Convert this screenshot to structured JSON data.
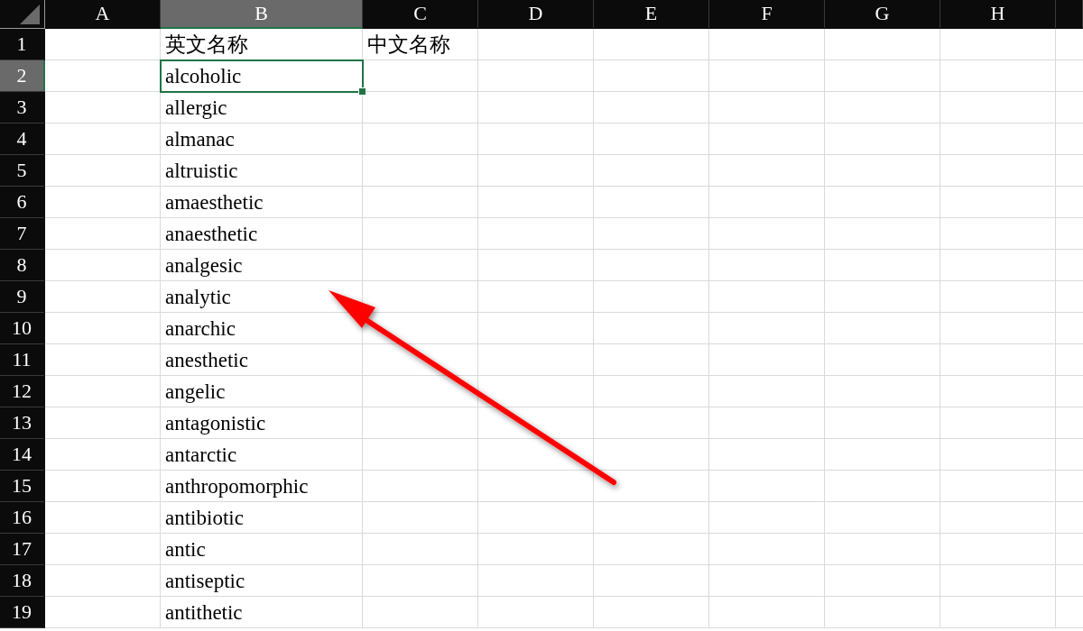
{
  "columns": [
    {
      "label": "A",
      "selected": false
    },
    {
      "label": "B",
      "selected": true
    },
    {
      "label": "C",
      "selected": false
    },
    {
      "label": "D",
      "selected": false
    },
    {
      "label": "E",
      "selected": false
    },
    {
      "label": "F",
      "selected": false
    },
    {
      "label": "G",
      "selected": false
    },
    {
      "label": "H",
      "selected": false
    }
  ],
  "rows": [
    {
      "number": "1",
      "selected": false,
      "column_b": "英文名称",
      "column_c": "中文名称"
    },
    {
      "number": "2",
      "selected": true,
      "column_b": "alcoholic"
    },
    {
      "number": "3",
      "selected": false,
      "column_b": "allergic"
    },
    {
      "number": "4",
      "selected": false,
      "column_b": "almanac"
    },
    {
      "number": "5",
      "selected": false,
      "column_b": "altruistic"
    },
    {
      "number": "6",
      "selected": false,
      "column_b": "amaesthetic"
    },
    {
      "number": "7",
      "selected": false,
      "column_b": "anaesthetic"
    },
    {
      "number": "8",
      "selected": false,
      "column_b": "analgesic"
    },
    {
      "number": "9",
      "selected": false,
      "column_b": "analytic"
    },
    {
      "number": "10",
      "selected": false,
      "column_b": "anarchic"
    },
    {
      "number": "11",
      "selected": false,
      "column_b": "anesthetic"
    },
    {
      "number": "12",
      "selected": false,
      "column_b": "angelic"
    },
    {
      "number": "13",
      "selected": false,
      "column_b": "antagonistic"
    },
    {
      "number": "14",
      "selected": false,
      "column_b": "antarctic"
    },
    {
      "number": "15",
      "selected": false,
      "column_b": "anthropomorphic"
    },
    {
      "number": "16",
      "selected": false,
      "column_b": "antibiotic"
    },
    {
      "number": "17",
      "selected": false,
      "column_b": "antic"
    },
    {
      "number": "18",
      "selected": false,
      "column_b": "antiseptic"
    },
    {
      "number": "19",
      "selected": false,
      "column_b": "antithetic"
    }
  ]
}
